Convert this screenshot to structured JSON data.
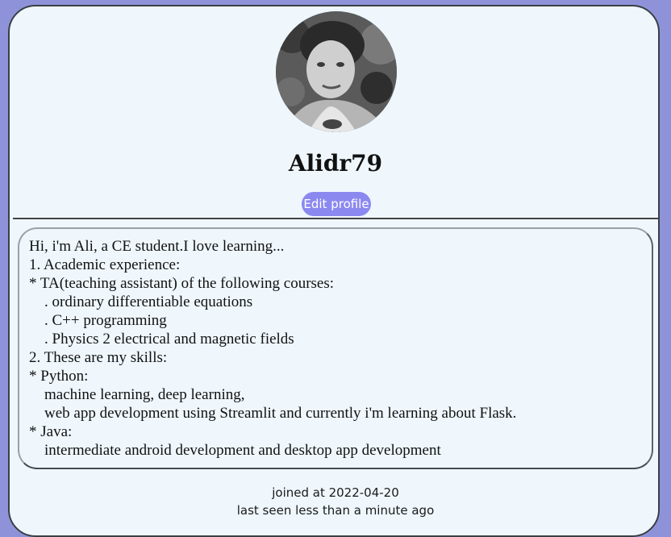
{
  "profile": {
    "avatar_icon": "profile-photo",
    "username": "Alidr79",
    "edit_label": "Edit profile",
    "edit_color": "#8b89f0",
    "bio_lines": [
      "Hi, i'm Ali, a CE student.I love learning...",
      "1. Academic experience:",
      "* TA(teaching assistant) of the following courses:",
      "    . ordinary differentiable equations",
      "    . C++ programming",
      "    . Physics 2 electrical and magnetic fields",
      "2. These are my skills:",
      "* Python:",
      "    machine learning, deep learning,",
      "    web app development using Streamlit and currently i'm learning about Flask.",
      "* Java:",
      "    intermediate android development and desktop app development"
    ],
    "joined": "joined at 2022-04-20",
    "last_seen": "last seen less than a minute ago"
  },
  "colors": {
    "page_background": "#8e93d9",
    "card_background": "#eff7fd"
  }
}
